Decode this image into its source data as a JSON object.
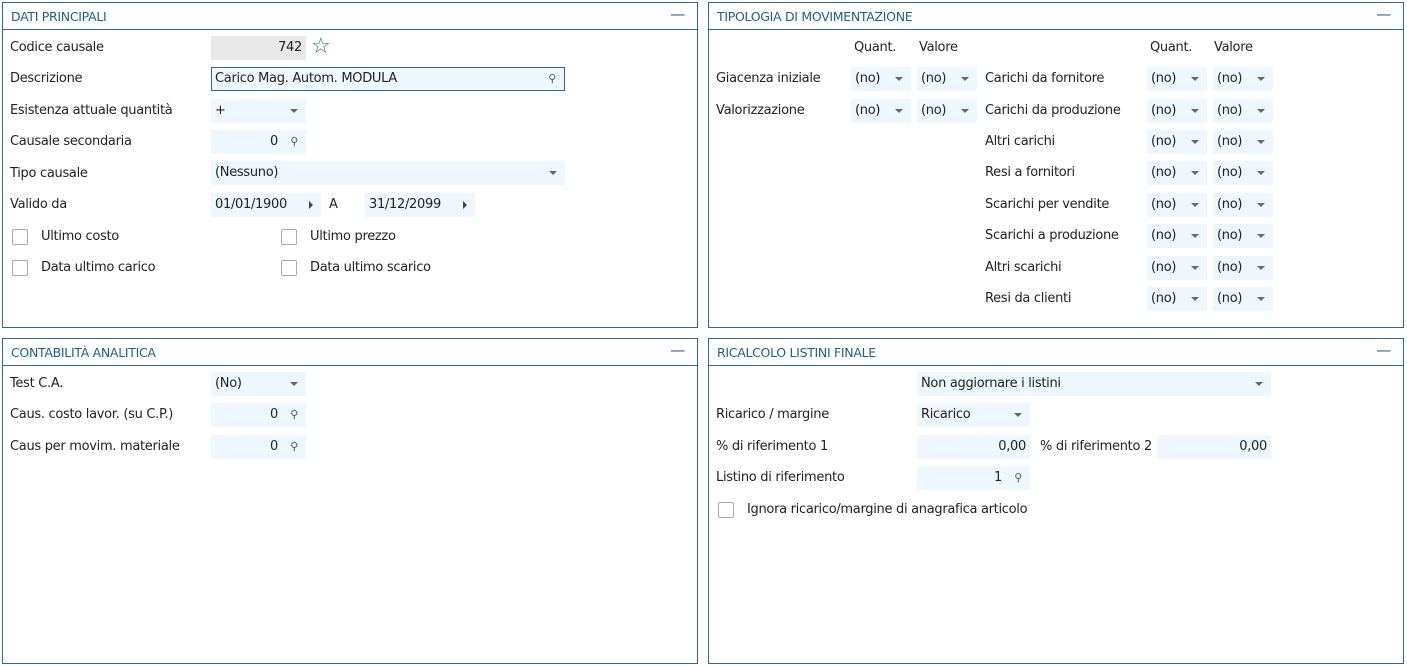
{
  "dati": {
    "title": "DATI PRINCIPALI",
    "codice_label": "Codice causale",
    "codice": "742",
    "descr_label": "Descrizione",
    "descr": "Carico Mag. Autom. MODULA",
    "esist_label": "Esistenza attuale quantità",
    "esist": "+",
    "sec_label": "Causale secondaria",
    "sec": "0",
    "tipo_label": "Tipo causale",
    "tipo": "(Nessuno)",
    "valido_label": "Valido da",
    "da": "01/01/1900",
    "a_label": "A",
    "a": "31/12/2099",
    "ultimo_costo": "Ultimo costo",
    "ultimo_prezzo": "Ultimo prezzo",
    "data_carico": "Data ultimo carico",
    "data_scarico": "Data ultimo scarico"
  },
  "tipologia": {
    "title": "TIPOLOGIA DI MOVIMENTAZIONE",
    "quant": "Quant.",
    "valore": "Valore",
    "left": [
      {
        "label": "Giacenza iniziale",
        "q": "(no)",
        "v": "(no)"
      },
      {
        "label": "Valorizzazione",
        "q": "(no)",
        "v": "(no)"
      }
    ],
    "right": [
      {
        "label": "Carichi da fornitore",
        "q": "(no)",
        "v": "(no)"
      },
      {
        "label": "Carichi da produzione",
        "q": "(no)",
        "v": "(no)"
      },
      {
        "label": "Altri carichi",
        "q": "(no)",
        "v": "(no)"
      },
      {
        "label": "Resi a fornitori",
        "q": "(no)",
        "v": "(no)"
      },
      {
        "label": "Scarichi per vendite",
        "q": "(no)",
        "v": "(no)"
      },
      {
        "label": "Scarichi a produzione",
        "q": "(no)",
        "v": "(no)"
      },
      {
        "label": "Altri scarichi",
        "q": "(no)",
        "v": "(no)"
      },
      {
        "label": "Resi da clienti",
        "q": "(no)",
        "v": "(no)"
      }
    ]
  },
  "contab": {
    "title": "CONTABILITÀ ANALITICA",
    "test_label": "Test C.A.",
    "test": "(No)",
    "costo_label": "Caus. costo lavor. (su C.P.)",
    "costo": "0",
    "mat_label": "Caus per movim. materiale",
    "mat": "0"
  },
  "ricalcolo": {
    "title": "Ricalcolo listini finale",
    "aggiorna": "Non aggiornare i listini",
    "ric_label": "Ricarico / margine",
    "ric": "Ricarico",
    "p1_label": "% di riferimento 1",
    "p1": "0,00",
    "p2_label": "% di riferimento 2",
    "p2": "0,00",
    "listino_label": "Listino di riferimento",
    "listino": "1",
    "ignora": "Ignora ricarico/margine di anagrafica articolo"
  },
  "minimize": "—"
}
